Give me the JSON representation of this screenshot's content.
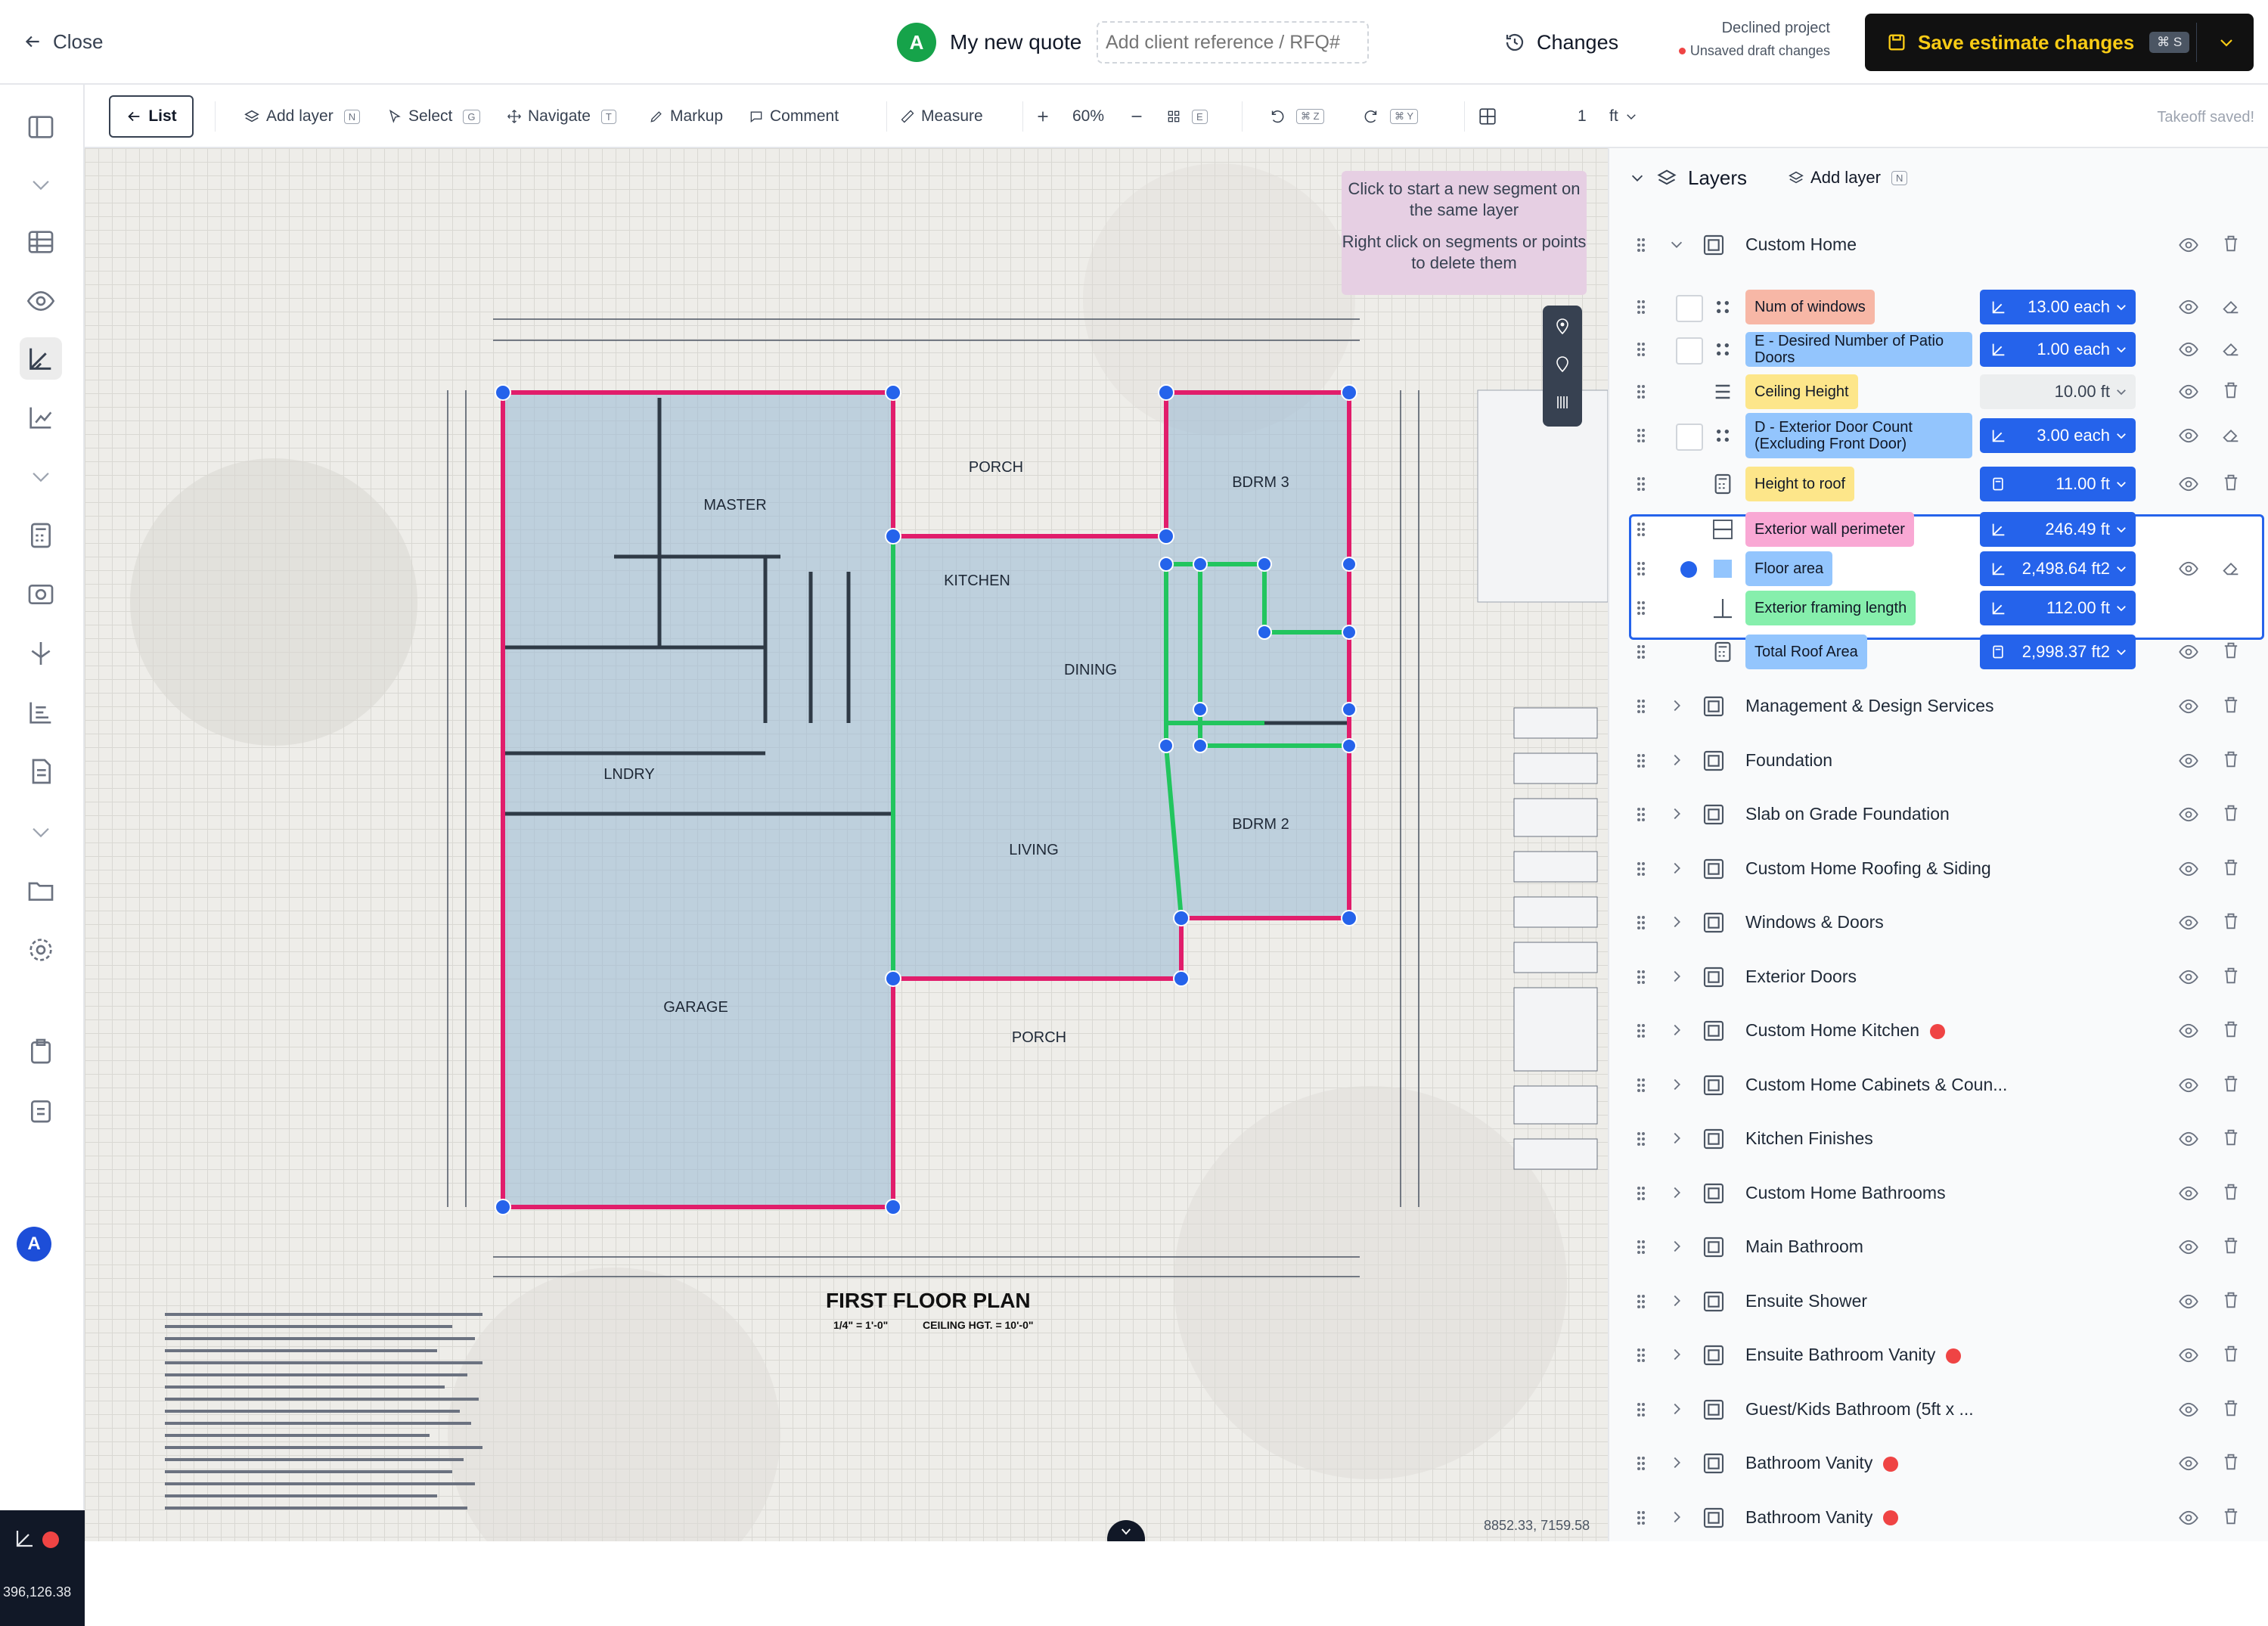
{
  "header": {
    "close_label": "Close",
    "avatar_letter": "A",
    "quote_name": "My new quote",
    "client_ref_placeholder": "Add client reference / RFQ#",
    "changes_label": "Changes",
    "project_status": "Declined project",
    "draft_status": "Unsaved draft changes",
    "save_label": "Save estimate changes",
    "save_shortcut": "⌘ S"
  },
  "toolbar": {
    "list": "List",
    "add_layer": "Add layer",
    "add_layer_key": "N",
    "select": "Select",
    "select_key": "G",
    "navigate": "Navigate",
    "navigate_key": "T",
    "markup": "Markup",
    "comment": "Comment",
    "measure": "Measure",
    "zoom": "60%",
    "grid_key": "E",
    "undo_key": "⌘ Z",
    "redo_key": "⌘ Y",
    "scale_value": "1",
    "scale_unit": "ft",
    "status": "Takeoff saved!"
  },
  "canvas": {
    "hint_1": "Click to start a new segment on the same layer",
    "hint_2": "Right click on segments or points to delete them",
    "coords": "8852.33, 7159.58",
    "plan_title": "FIRST FLOOR PLAN",
    "plan_scale": "1/4\" = 1'-0\"",
    "ceiling": "CEILING HGT. = 10'-0\"",
    "rooms": {
      "porch_top": "PORCH",
      "master": "MASTER",
      "bdrm3": "BDRM 3",
      "kitchen": "KITCHEN",
      "dining": "DINING",
      "lndry": "LNDRY",
      "living": "LIVING",
      "bdrm2": "BDRM 2",
      "garage": "GARAGE",
      "porch_bottom": "PORCH"
    }
  },
  "left_rail": {
    "user_initial": "A",
    "coords": "396,126.38"
  },
  "layers_panel": {
    "title": "Layers",
    "add_layer": "Add layer",
    "add_layer_key": "N",
    "group_name": "Custom Home",
    "items": [
      {
        "label": "Num of windows",
        "value": "13.00",
        "unit": "each",
        "chip_color": "#f7b7a6"
      },
      {
        "label": "E - Desired Number of Patio Doors",
        "value": "1.00",
        "unit": "each",
        "chip_color": "#93c5fd"
      },
      {
        "label": "Ceiling Height",
        "value": "10.00",
        "unit": "ft",
        "chip_color": "#fde68a"
      },
      {
        "label": "D - Exterior Door Count (Excluding Front Door)",
        "value": "3.00",
        "unit": "each",
        "chip_color": "#93c5fd"
      },
      {
        "label": "Height to roof",
        "value": "11.00",
        "unit": "ft",
        "chip_color": "#fde68a"
      },
      {
        "label": "Exterior wall perimeter",
        "value": "246.49",
        "unit": "ft",
        "chip_color": "#f9a8d4"
      },
      {
        "label": "Floor area",
        "value": "2,498.64",
        "unit": "ft2",
        "chip_color": "#93c5fd"
      },
      {
        "label": "Exterior framing length",
        "value": "112.00",
        "unit": "ft",
        "chip_color": "#86efac"
      },
      {
        "label": "Total Roof Area",
        "value": "2,998.37",
        "unit": "ft2",
        "chip_color": "#93c5fd"
      }
    ],
    "groups": [
      {
        "name": "Management & Design Services",
        "flag": false
      },
      {
        "name": "Foundation",
        "flag": false
      },
      {
        "name": "Slab on Grade Foundation",
        "flag": false
      },
      {
        "name": "Custom Home Roofing & Siding",
        "flag": false
      },
      {
        "name": "Windows & Doors",
        "flag": false
      },
      {
        "name": "Exterior Doors",
        "flag": false
      },
      {
        "name": "Custom Home Kitchen",
        "flag": true
      },
      {
        "name": "Custom Home Cabinets & Coun...",
        "flag": false
      },
      {
        "name": "Kitchen Finishes",
        "flag": false
      },
      {
        "name": "Custom Home Bathrooms",
        "flag": false
      },
      {
        "name": "Main Bathroom",
        "flag": false
      },
      {
        "name": "Ensuite Shower",
        "flag": false
      },
      {
        "name": "Ensuite Bathroom Vanity",
        "flag": true
      },
      {
        "name": "Guest/Kids Bathroom (5ft x ...",
        "flag": false
      },
      {
        "name": "Bathroom Vanity",
        "flag": true
      },
      {
        "name": "Bathroom Vanity",
        "flag": true
      }
    ]
  },
  "colors": {
    "accent": "#2563eb",
    "save_text": "#facc15",
    "perimeter": "#e11d6b",
    "framing": "#22c55e"
  }
}
